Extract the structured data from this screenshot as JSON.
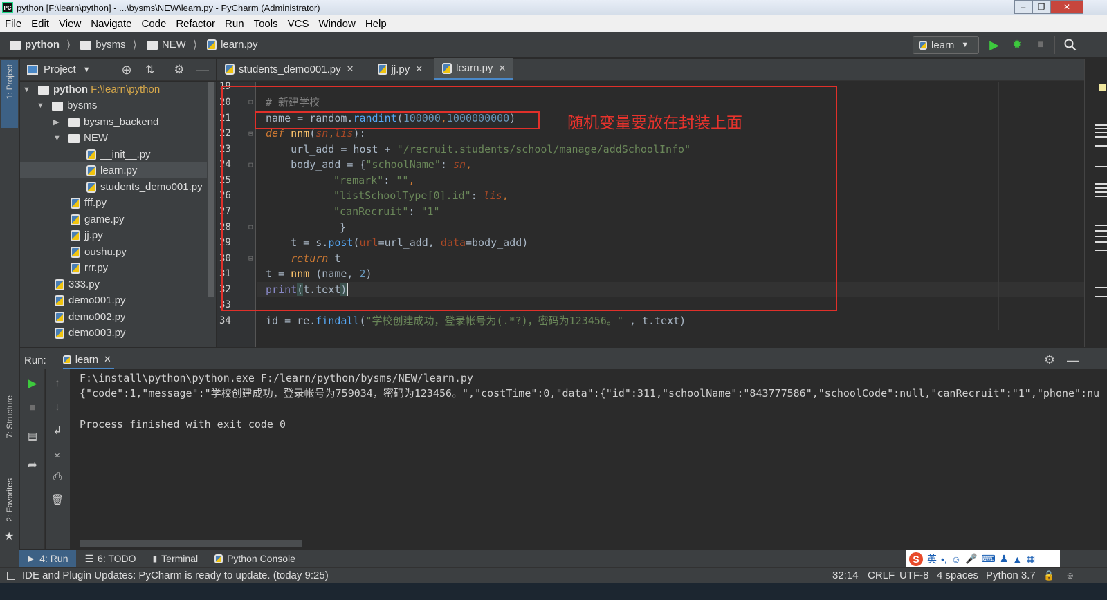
{
  "window": {
    "title": "python [F:\\learn\\python] - ...\\bysms\\NEW\\learn.py - PyCharm (Administrator)",
    "app_icon": "PC",
    "background_title": "..."
  },
  "menu": [
    "File",
    "Edit",
    "View",
    "Navigate",
    "Code",
    "Refactor",
    "Run",
    "Tools",
    "VCS",
    "Window",
    "Help"
  ],
  "breadcrumb": [
    "python",
    "bysms",
    "NEW",
    "learn.py"
  ],
  "run_config": "learn",
  "project_panel": {
    "title": "Project",
    "tree": [
      {
        "label": "python",
        "path": "F:\\learn\\python",
        "type": "folder",
        "level": 0,
        "expanded": true
      },
      {
        "label": "bysms",
        "type": "folder",
        "level": 1,
        "expanded": true
      },
      {
        "label": "bysms_backend",
        "type": "folder",
        "level": 2,
        "expanded": false
      },
      {
        "label": "NEW",
        "type": "folder",
        "level": 2,
        "expanded": true
      },
      {
        "label": "__init__.py",
        "type": "py",
        "level": 3
      },
      {
        "label": "learn.py",
        "type": "py",
        "level": 3,
        "selected": true
      },
      {
        "label": "students_demo001.py",
        "type": "py",
        "level": 3
      },
      {
        "label": "fff.py",
        "type": "py",
        "level": 2
      },
      {
        "label": "game.py",
        "type": "py",
        "level": 2
      },
      {
        "label": "jj.py",
        "type": "py",
        "level": 2
      },
      {
        "label": "oushu.py",
        "type": "py",
        "level": 2
      },
      {
        "label": "rrr.py",
        "type": "py",
        "level": 2
      },
      {
        "label": "333.py",
        "type": "py",
        "level": 1
      },
      {
        "label": "demo001.py",
        "type": "py",
        "level": 1
      },
      {
        "label": "demo002.py",
        "type": "py",
        "level": 1
      },
      {
        "label": "demo003.py",
        "type": "py",
        "level": 1
      }
    ]
  },
  "editor_tabs": [
    {
      "label": "students_demo001.py",
      "active": false
    },
    {
      "label": "jj.py",
      "active": false
    },
    {
      "label": "learn.py",
      "active": true
    }
  ],
  "gutter_numbers": [
    "19",
    "20",
    "21",
    "22",
    "23",
    "24",
    "25",
    "26",
    "27",
    "28",
    "29",
    "30",
    "31",
    "32",
    "33",
    "34"
  ],
  "code": {
    "l20_comment": "# 新建学校",
    "l21_name": "name",
    "l21_eq": " = ",
    "l21_mod": "random.",
    "l21_fn": "randint",
    "l21_a": "(",
    "l21_n1": "100000",
    "l21_comma": ",",
    "l21_n2": "1000000000",
    "l21_b": ")",
    "l22_def": "def",
    "l22_fn": " nnm",
    "l22_p1": "(",
    "l22_sn": "sn",
    "l22_c": ",",
    "l22_lis": "lis",
    "l22_p2": "):",
    "l23_a": "    url_add = host + ",
    "l23_str": "\"/recruit.students/school/manage/addSchoolInfo\"",
    "l24_a": "    body_add = {",
    "l24_str": "\"schoolName\"",
    "l24_b": ": ",
    "l24_sn": "sn",
    "l24_c": ",",
    "l25_str": "\"remark\"",
    "l25_b": ": ",
    "l25_str2": "\"\"",
    "l25_c": ",",
    "l26_str": "\"listSchoolType[0].id\"",
    "l26_b": ": ",
    "l26_lis": "lis",
    "l26_c": ",",
    "l27_str": "\"canRecruit\"",
    "l27_b": ": ",
    "l27_str2": "\"1\"",
    "l28": "}",
    "l29_a": "    t = s.",
    "l29_fn": "post",
    "l29_b": "(",
    "l29_k1": "url",
    "l29_c": "=url_add, ",
    "l29_k2": "data",
    "l29_d": "=body_add)",
    "l30_kw": "    return",
    "l30_b": " t",
    "l31_a": "t = ",
    "l31_fn": "nnm",
    "l31_b": " (name, ",
    "l31_num": "2",
    "l31_c": ")",
    "l32_bi": "print",
    "l32_b": "(",
    "l32_c": "t.text",
    "l32_d": ")",
    "l34_a": "id = re.",
    "l34_fn": "findall",
    "l34_b": "(",
    "l34_str": "\"学校创建成功，登录帐号为(.*?)，密码为123456。\"",
    "l34_c": " , t.text)"
  },
  "annotation_text": "随机变量要放在封装上面",
  "run_panel": {
    "label": "Run:",
    "tab": "learn",
    "lines": [
      "F:\\install\\python\\python.exe F:/learn/python/bysms/NEW/learn.py",
      "{\"code\":1,\"message\":\"学校创建成功，登录帐号为759034，密码为123456。\",\"costTime\":0,\"data\":{\"id\":311,\"schoolName\":\"843777586\",\"schoolCode\":null,\"canRecruit\":\"1\",\"phone\":nu",
      "",
      "Process finished with exit code 0"
    ]
  },
  "bottom_tabs": [
    {
      "label": "4: Run",
      "active": true,
      "icon": "play-icon"
    },
    {
      "label": "6: TODO",
      "active": false,
      "icon": "list-icon"
    },
    {
      "label": "Terminal",
      "active": false,
      "icon": "terminal-icon"
    },
    {
      "label": "Python Console",
      "active": false,
      "icon": "python-icon"
    }
  ],
  "left_tool_windows": [
    "1: Project",
    "7: Structure",
    "2: Favorites"
  ],
  "status": {
    "message": "IDE and Plugin Updates: PyCharm is ready to update. (today 9:25)",
    "position": "32:14",
    "line_sep": "CRLF",
    "encoding": "UTF-8",
    "indent": "4 spaces",
    "interpreter": "Python 3.7"
  },
  "ime": {
    "mode": "英"
  },
  "colors": {
    "accent": "#4a88c7",
    "annotation": "#e0302a",
    "run_green": "#3dc93d"
  }
}
